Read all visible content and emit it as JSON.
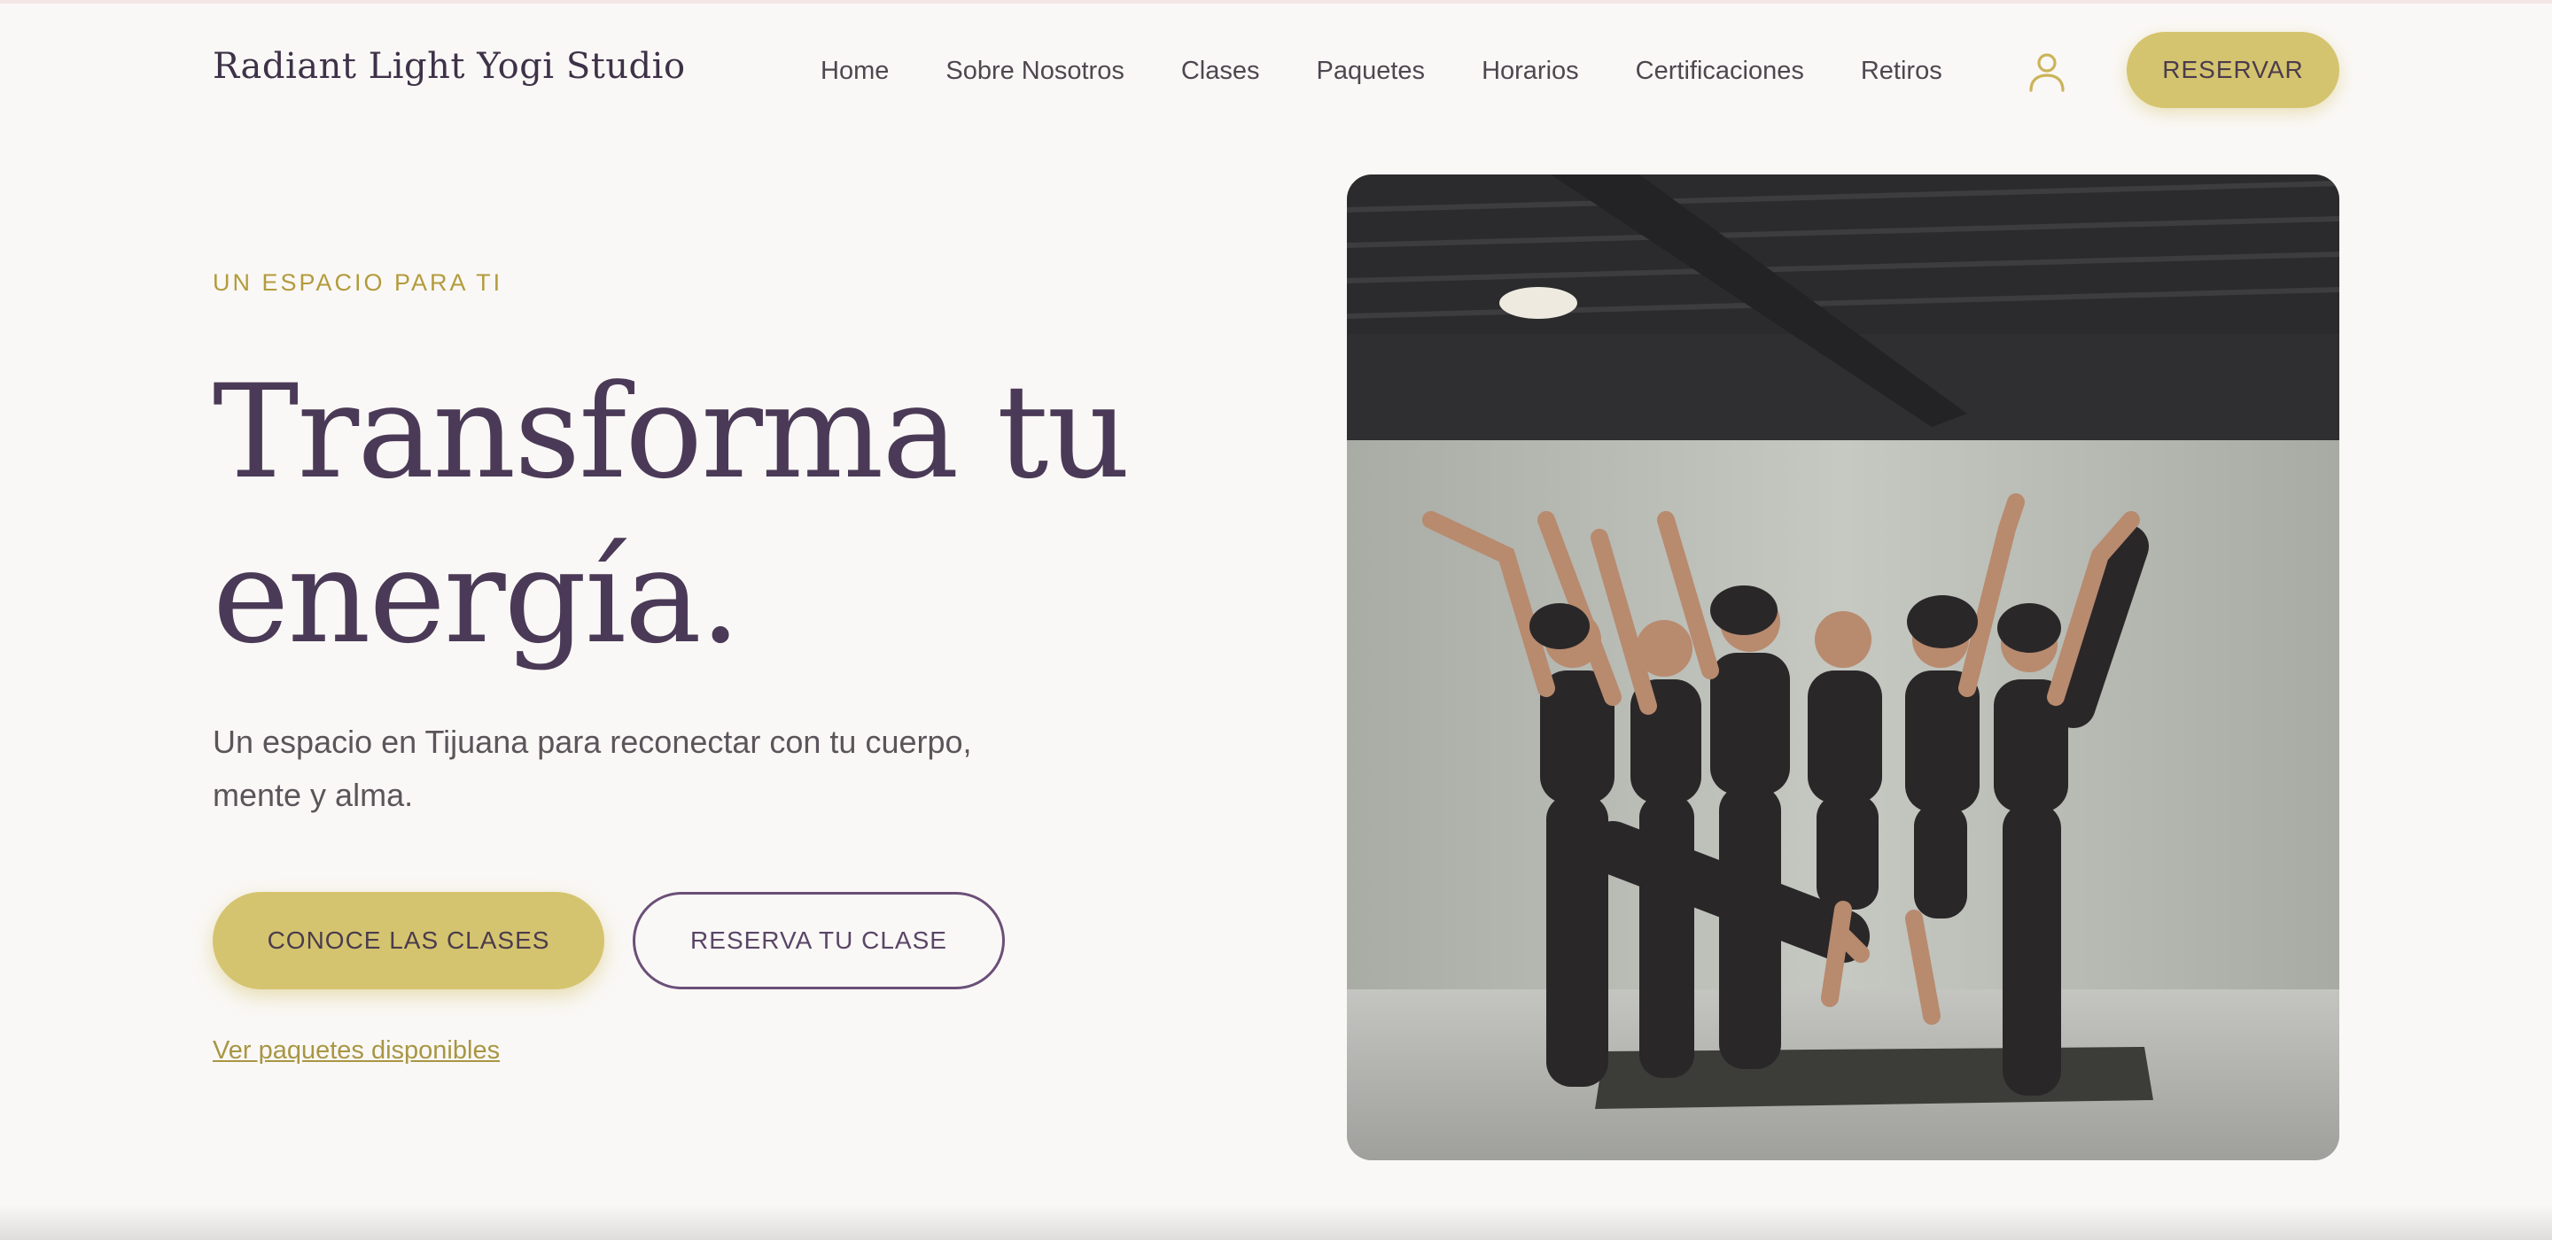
{
  "header": {
    "logo": "Radiant Light Yogi Studio",
    "nav": [
      "Home",
      "Sobre Nosotros",
      "Clases",
      "Paquetes",
      "Horarios",
      "Certificaciones",
      "Retiros"
    ],
    "account_icon": "user-icon",
    "cta_label": "RESERVAR"
  },
  "hero": {
    "eyebrow": "UN ESPACIO PARA TI",
    "headline_line1": "Transforma tu",
    "headline_line2": "energía.",
    "subtext": "Un espacio en Tijuana para reconectar con tu cuerpo, mente y alma.",
    "primary_cta": "CONOCE LAS CLASES",
    "secondary_cta": "RESERVA TU CLASE",
    "link": "Ver paquetes disponibles"
  },
  "colors": {
    "background": "#faf8f6",
    "accent_gold": "#d5c46f",
    "headline_plum": "#4b3a57",
    "eyebrow_gold": "#b39b3d",
    "outline_plum": "#6b4f78"
  }
}
